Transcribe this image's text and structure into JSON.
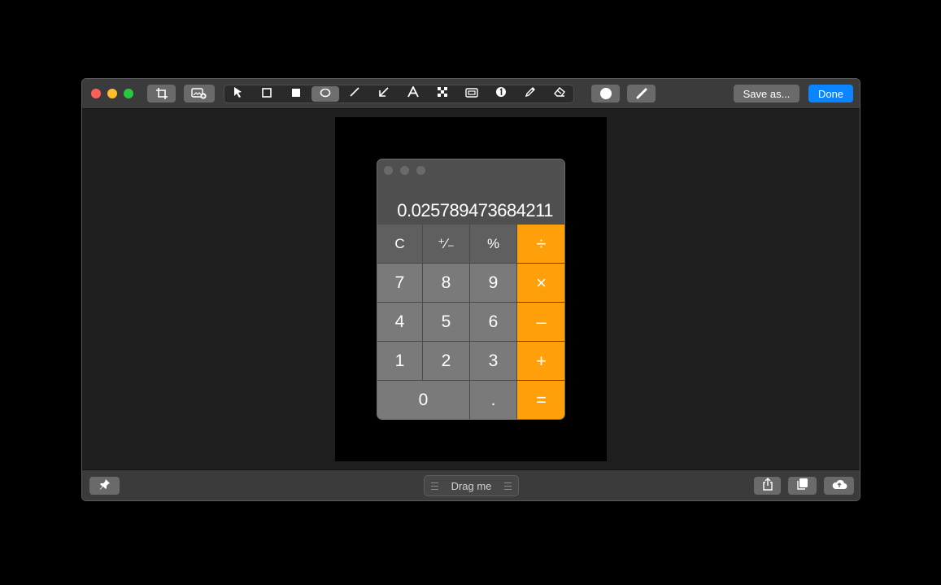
{
  "toolbar": {
    "tools": [
      {
        "name": "arrow-pointer-tool",
        "icon": "cursor-icon"
      },
      {
        "name": "rectangle-outline-tool",
        "icon": "square-outline-icon"
      },
      {
        "name": "rectangle-filled-tool",
        "icon": "square-filled-icon"
      },
      {
        "name": "ellipse-tool",
        "icon": "circle-outline-icon",
        "active": true
      },
      {
        "name": "line-tool",
        "icon": "line-icon"
      },
      {
        "name": "arrow-tool",
        "icon": "arrow-down-left-icon"
      },
      {
        "name": "text-tool",
        "icon": "text-a-icon"
      },
      {
        "name": "pixelate-tool",
        "icon": "pixelate-icon"
      },
      {
        "name": "highlight-tool",
        "icon": "highlight-box-icon"
      },
      {
        "name": "counter-tool",
        "icon": "number-one-icon"
      },
      {
        "name": "pencil-tool",
        "icon": "pencil-icon"
      },
      {
        "name": "eraser-tool",
        "icon": "eraser-icon"
      }
    ],
    "save_as_label": "Save as...",
    "done_label": "Done",
    "accent_color": "#0a84ff"
  },
  "calculator": {
    "display": "0.025789473684211",
    "keys": [
      [
        "C",
        "⁺∕₋",
        "%",
        "÷"
      ],
      [
        "7",
        "8",
        "9",
        "×"
      ],
      [
        "4",
        "5",
        "6",
        "–"
      ],
      [
        "1",
        "2",
        "3",
        "+"
      ],
      [
        "0",
        ".",
        "="
      ]
    ],
    "operator_color": "#ff9f0a"
  },
  "bottombar": {
    "drag_label": "Drag me"
  }
}
